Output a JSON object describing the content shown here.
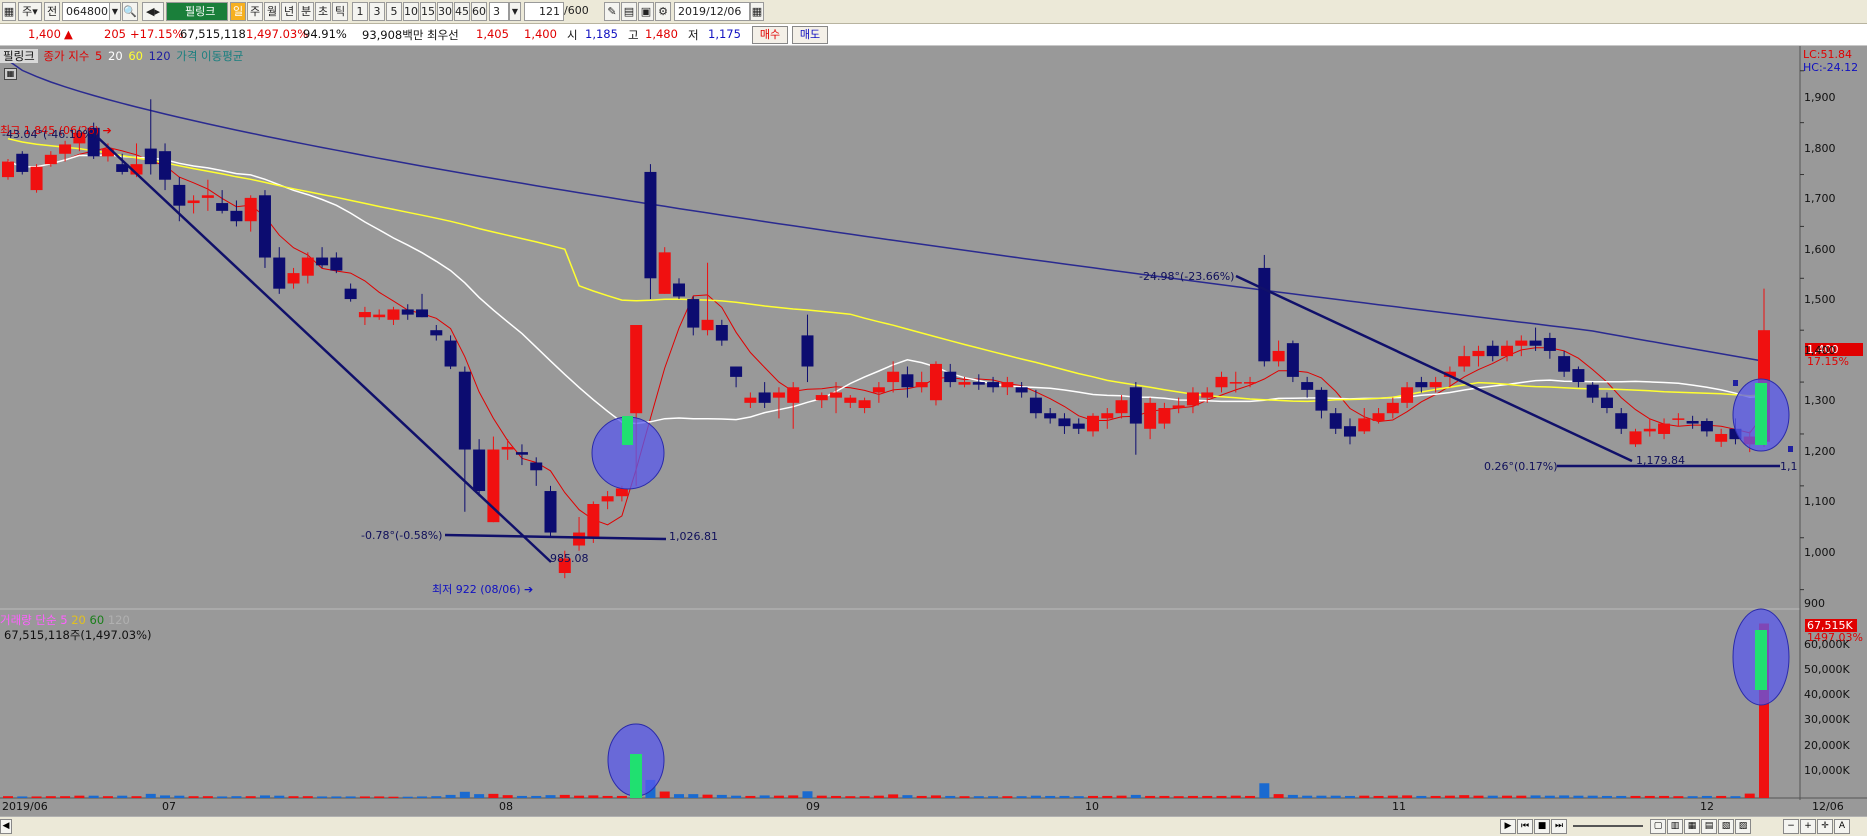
{
  "toolbar": {
    "type_label": "주",
    "period_label": "전",
    "code": "064800",
    "stock_name": "필링크",
    "mode_char": "일",
    "periods": [
      "주",
      "월",
      "년",
      "분",
      "초",
      "틱"
    ],
    "intervals": [
      "1",
      "3",
      "5",
      "10",
      "15",
      "30",
      "45",
      "60"
    ],
    "interval_value": "3",
    "count": "121",
    "count_max": "/600",
    "date": "2019/12/06"
  },
  "info": {
    "price": "1,400",
    "change": "205",
    "change_pct": "+17.15%",
    "volume": "67,515,118",
    "volume_ratio": "1,497.03%",
    "strength": "94.91%",
    "amount": "93,908백만",
    "ask_label": "최우선",
    "ask": "1,405",
    "bid": "1,400",
    "open_label": "시",
    "open": "1,185",
    "high_label": "고",
    "high": "1,480",
    "low_label": "저",
    "low": "1,175",
    "buy_label": "매수",
    "sell_label": "매도"
  },
  "legend_price": {
    "name": "필링크",
    "ma_label": "종가 지수",
    "ma5": "5",
    "ma20": "20",
    "ma60": "60",
    "ma120": "120",
    "title": "가격 이동평균"
  },
  "legend_volume": {
    "name": "거래량",
    "ma_label": "단순",
    "ma5": "5",
    "ma20": "20",
    "ma60": "60",
    "ma120": "120",
    "info": "67,515,118주(1,497.03%)"
  },
  "right_info": {
    "lc": "LC:51.84",
    "hc": "HC:-24.12",
    "price_tag": "1,400",
    "price_pct": "17.15%",
    "vol_tag": "67,515K",
    "vol_pct": "1497.03%"
  },
  "y_axis_price": [
    "1,900",
    "1,800",
    "1,700",
    "1,600",
    "1,500",
    "1,400",
    "1,300",
    "1,200",
    "1,100",
    "1,000",
    "900"
  ],
  "y_axis_volume": [
    "60,000K",
    "50,000K",
    "40,000K",
    "30,000K",
    "20,000K",
    "10,000K"
  ],
  "x_axis": [
    "2019/06",
    "07",
    "08",
    "09",
    "10",
    "11",
    "12",
    "12/06"
  ],
  "annotations": {
    "high_label": "최고 1,845 (06/26)",
    "low_label": "최저 922 (08/06)",
    "trend1_angle": "-43.04°(-46.10%)",
    "trend2_angle": "-0.78°(-0.58%)",
    "trend2_value": "1,026.81",
    "trend2_low": "985.08",
    "trend3_angle": "-24.98°(-23.66%)",
    "trend4_angle": "0.26°(0.17%)",
    "trend4_value": "1,179.84",
    "trend4_right": "1,1"
  },
  "chart_data": {
    "type": "candlestick",
    "x_range": [
      "2019/06",
      "2019/12/06"
    ],
    "price_ylim": [
      880,
      1940
    ],
    "volume_ylim": [
      0,
      65000
    ],
    "candles": [
      {
        "o": 1695,
        "h": 1730,
        "l": 1690,
        "c": 1725,
        "v": 700
      },
      {
        "o": 1740,
        "h": 1745,
        "l": 1700,
        "c": 1705,
        "v": 600
      },
      {
        "o": 1670,
        "h": 1720,
        "l": 1665,
        "c": 1715,
        "v": 600
      },
      {
        "o": 1720,
        "h": 1745,
        "l": 1715,
        "c": 1738,
        "v": 700
      },
      {
        "o": 1740,
        "h": 1765,
        "l": 1725,
        "c": 1758,
        "v": 700
      },
      {
        "o": 1760,
        "h": 1790,
        "l": 1745,
        "c": 1780,
        "v": 900
      },
      {
        "o": 1790,
        "h": 1800,
        "l": 1730,
        "c": 1735,
        "v": 900
      },
      {
        "o": 1735,
        "h": 1760,
        "l": 1725,
        "c": 1750,
        "v": 700
      },
      {
        "o": 1720,
        "h": 1740,
        "l": 1700,
        "c": 1705,
        "v": 900
      },
      {
        "o": 1700,
        "h": 1760,
        "l": 1695,
        "c": 1720,
        "v": 700
      },
      {
        "o": 1750,
        "h": 1845,
        "l": 1700,
        "c": 1720,
        "v": 1600
      },
      {
        "o": 1745,
        "h": 1760,
        "l": 1670,
        "c": 1690,
        "v": 1000
      },
      {
        "o": 1680,
        "h": 1695,
        "l": 1610,
        "c": 1640,
        "v": 900
      },
      {
        "o": 1645,
        "h": 1660,
        "l": 1625,
        "c": 1650,
        "v": 700
      },
      {
        "o": 1655,
        "h": 1690,
        "l": 1630,
        "c": 1660,
        "v": 700
      },
      {
        "o": 1645,
        "h": 1670,
        "l": 1625,
        "c": 1630,
        "v": 600
      },
      {
        "o": 1630,
        "h": 1650,
        "l": 1600,
        "c": 1610,
        "v": 700
      },
      {
        "o": 1610,
        "h": 1660,
        "l": 1590,
        "c": 1655,
        "v": 700
      },
      {
        "o": 1660,
        "h": 1670,
        "l": 1520,
        "c": 1540,
        "v": 1000
      },
      {
        "o": 1540,
        "h": 1560,
        "l": 1470,
        "c": 1480,
        "v": 900
      },
      {
        "o": 1490,
        "h": 1520,
        "l": 1480,
        "c": 1510,
        "v": 700
      },
      {
        "o": 1505,
        "h": 1550,
        "l": 1490,
        "c": 1540,
        "v": 700
      },
      {
        "o": 1540,
        "h": 1560,
        "l": 1520,
        "c": 1525,
        "v": 600
      },
      {
        "o": 1540,
        "h": 1550,
        "l": 1510,
        "c": 1515,
        "v": 600
      },
      {
        "o": 1480,
        "h": 1490,
        "l": 1455,
        "c": 1460,
        "v": 600
      },
      {
        "o": 1425,
        "h": 1445,
        "l": 1410,
        "c": 1435,
        "v": 600
      },
      {
        "o": 1425,
        "h": 1440,
        "l": 1420,
        "c": 1430,
        "v": 600
      },
      {
        "o": 1420,
        "h": 1445,
        "l": 1410,
        "c": 1440,
        "v": 500
      },
      {
        "o": 1440,
        "h": 1450,
        "l": 1420,
        "c": 1430,
        "v": 500
      },
      {
        "o": 1440,
        "h": 1470,
        "l": 1425,
        "c": 1425,
        "v": 600
      },
      {
        "o": 1400,
        "h": 1410,
        "l": 1380,
        "c": 1390,
        "v": 700
      },
      {
        "o": 1380,
        "h": 1390,
        "l": 1325,
        "c": 1330,
        "v": 1200
      },
      {
        "o": 1320,
        "h": 1330,
        "l": 1050,
        "c": 1170,
        "v": 2400
      },
      {
        "o": 1170,
        "h": 1190,
        "l": 1080,
        "c": 1090,
        "v": 1500
      },
      {
        "o": 1030,
        "h": 1195,
        "l": 1030,
        "c": 1170,
        "v": 1600
      },
      {
        "o": 1170,
        "h": 1190,
        "l": 1150,
        "c": 1175,
        "v": 1100
      },
      {
        "o": 1165,
        "h": 1180,
        "l": 1140,
        "c": 1160,
        "v": 800
      },
      {
        "o": 1145,
        "h": 1155,
        "l": 1100,
        "c": 1130,
        "v": 800
      },
      {
        "o": 1090,
        "h": 1100,
        "l": 1000,
        "c": 1010,
        "v": 1100
      },
      {
        "o": 932,
        "h": 975,
        "l": 922,
        "c": 960,
        "v": 1200
      },
      {
        "o": 985,
        "h": 1040,
        "l": 975,
        "c": 1010,
        "v": 900
      },
      {
        "o": 1000,
        "h": 1070,
        "l": 990,
        "c": 1065,
        "v": 1000
      },
      {
        "o": 1070,
        "h": 1090,
        "l": 1055,
        "c": 1080,
        "v": 800
      },
      {
        "o": 1080,
        "h": 1100,
        "l": 1070,
        "c": 1095,
        "v": 800
      },
      {
        "o": 1240,
        "h": 1340,
        "l": 1100,
        "c": 1410,
        "v": 4500
      },
      {
        "o": 1705,
        "h": 1720,
        "l": 1460,
        "c": 1500,
        "v": 7000
      },
      {
        "o": 1470,
        "h": 1560,
        "l": 1470,
        "c": 1550,
        "v": 2500
      },
      {
        "o": 1490,
        "h": 1500,
        "l": 1460,
        "c": 1465,
        "v": 1500
      },
      {
        "o": 1460,
        "h": 1465,
        "l": 1390,
        "c": 1405,
        "v": 1500
      },
      {
        "o": 1400,
        "h": 1530,
        "l": 1390,
        "c": 1420,
        "v": 1300
      },
      {
        "o": 1410,
        "h": 1420,
        "l": 1370,
        "c": 1380,
        "v": 1200
      },
      {
        "o": 1330,
        "h": 1330,
        "l": 1290,
        "c": 1310,
        "v": 900
      },
      {
        "o": 1260,
        "h": 1280,
        "l": 1250,
        "c": 1270,
        "v": 800
      },
      {
        "o": 1280,
        "h": 1300,
        "l": 1250,
        "c": 1260,
        "v": 1000
      },
      {
        "o": 1270,
        "h": 1290,
        "l": 1230,
        "c": 1280,
        "v": 900
      },
      {
        "o": 1260,
        "h": 1300,
        "l": 1210,
        "c": 1290,
        "v": 1000
      },
      {
        "o": 1390,
        "h": 1430,
        "l": 1300,
        "c": 1330,
        "v": 2600
      },
      {
        "o": 1265,
        "h": 1280,
        "l": 1250,
        "c": 1275,
        "v": 900
      },
      {
        "o": 1270,
        "h": 1300,
        "l": 1240,
        "c": 1280,
        "v": 800
      },
      {
        "o": 1260,
        "h": 1275,
        "l": 1250,
        "c": 1270,
        "v": 700
      },
      {
        "o": 1250,
        "h": 1270,
        "l": 1240,
        "c": 1265,
        "v": 700
      },
      {
        "o": 1280,
        "h": 1300,
        "l": 1260,
        "c": 1290,
        "v": 900
      },
      {
        "o": 1300,
        "h": 1340,
        "l": 1280,
        "c": 1320,
        "v": 1400
      },
      {
        "o": 1315,
        "h": 1330,
        "l": 1270,
        "c": 1290,
        "v": 1100
      },
      {
        "o": 1290,
        "h": 1320,
        "l": 1280,
        "c": 1300,
        "v": 800
      },
      {
        "o": 1265,
        "h": 1340,
        "l": 1255,
        "c": 1335,
        "v": 1000
      },
      {
        "o": 1320,
        "h": 1335,
        "l": 1290,
        "c": 1300,
        "v": 800
      },
      {
        "o": 1295,
        "h": 1310,
        "l": 1290,
        "c": 1300,
        "v": 700
      },
      {
        "o": 1300,
        "h": 1315,
        "l": 1285,
        "c": 1295,
        "v": 700
      },
      {
        "o": 1300,
        "h": 1310,
        "l": 1280,
        "c": 1290,
        "v": 700
      },
      {
        "o": 1290,
        "h": 1310,
        "l": 1275,
        "c": 1300,
        "v": 700
      },
      {
        "o": 1290,
        "h": 1300,
        "l": 1270,
        "c": 1280,
        "v": 700
      },
      {
        "o": 1270,
        "h": 1285,
        "l": 1230,
        "c": 1240,
        "v": 900
      },
      {
        "o": 1240,
        "h": 1250,
        "l": 1220,
        "c": 1230,
        "v": 800
      },
      {
        "o": 1230,
        "h": 1240,
        "l": 1200,
        "c": 1215,
        "v": 800
      },
      {
        "o": 1220,
        "h": 1230,
        "l": 1200,
        "c": 1210,
        "v": 700
      },
      {
        "o": 1205,
        "h": 1240,
        "l": 1195,
        "c": 1235,
        "v": 800
      },
      {
        "o": 1230,
        "h": 1250,
        "l": 1210,
        "c": 1240,
        "v": 800
      },
      {
        "o": 1240,
        "h": 1275,
        "l": 1230,
        "c": 1265,
        "v": 900
      },
      {
        "o": 1290,
        "h": 1300,
        "l": 1160,
        "c": 1220,
        "v": 1200
      },
      {
        "o": 1210,
        "h": 1270,
        "l": 1190,
        "c": 1260,
        "v": 800
      },
      {
        "o": 1220,
        "h": 1260,
        "l": 1210,
        "c": 1250,
        "v": 800
      },
      {
        "o": 1250,
        "h": 1270,
        "l": 1240,
        "c": 1255,
        "v": 700
      },
      {
        "o": 1255,
        "h": 1290,
        "l": 1240,
        "c": 1280,
        "v": 800
      },
      {
        "o": 1270,
        "h": 1290,
        "l": 1260,
        "c": 1280,
        "v": 800
      },
      {
        "o": 1290,
        "h": 1320,
        "l": 1280,
        "c": 1310,
        "v": 800
      },
      {
        "o": 1300,
        "h": 1320,
        "l": 1280,
        "c": 1300,
        "v": 900
      },
      {
        "o": 1300,
        "h": 1310,
        "l": 1290,
        "c": 1300,
        "v": 800
      },
      {
        "o": 1520,
        "h": 1545,
        "l": 1330,
        "c": 1340,
        "v": 5700
      },
      {
        "o": 1340,
        "h": 1380,
        "l": 1330,
        "c": 1360,
        "v": 1500
      },
      {
        "o": 1375,
        "h": 1380,
        "l": 1300,
        "c": 1310,
        "v": 1200
      },
      {
        "o": 1300,
        "h": 1310,
        "l": 1270,
        "c": 1285,
        "v": 900
      },
      {
        "o": 1285,
        "h": 1290,
        "l": 1230,
        "c": 1245,
        "v": 900
      },
      {
        "o": 1240,
        "h": 1250,
        "l": 1200,
        "c": 1210,
        "v": 900
      },
      {
        "o": 1215,
        "h": 1230,
        "l": 1180,
        "c": 1195,
        "v": 800
      },
      {
        "o": 1205,
        "h": 1250,
        "l": 1200,
        "c": 1230,
        "v": 900
      },
      {
        "o": 1225,
        "h": 1250,
        "l": 1220,
        "c": 1240,
        "v": 800
      },
      {
        "o": 1240,
        "h": 1270,
        "l": 1230,
        "c": 1260,
        "v": 900
      },
      {
        "o": 1260,
        "h": 1300,
        "l": 1250,
        "c": 1290,
        "v": 1000
      },
      {
        "o": 1300,
        "h": 1310,
        "l": 1280,
        "c": 1290,
        "v": 800
      },
      {
        "o": 1290,
        "h": 1310,
        "l": 1280,
        "c": 1300,
        "v": 800
      },
      {
        "o": 1310,
        "h": 1330,
        "l": 1290,
        "c": 1320,
        "v": 900
      },
      {
        "o": 1330,
        "h": 1370,
        "l": 1320,
        "c": 1350,
        "v": 1100
      },
      {
        "o": 1350,
        "h": 1370,
        "l": 1330,
        "c": 1360,
        "v": 900
      },
      {
        "o": 1370,
        "h": 1380,
        "l": 1340,
        "c": 1350,
        "v": 900
      },
      {
        "o": 1350,
        "h": 1380,
        "l": 1340,
        "c": 1370,
        "v": 900
      },
      {
        "o": 1370,
        "h": 1390,
        "l": 1350,
        "c": 1380,
        "v": 900
      },
      {
        "o": 1380,
        "h": 1405,
        "l": 1360,
        "c": 1370,
        "v": 1000
      },
      {
        "o": 1385,
        "h": 1395,
        "l": 1345,
        "c": 1360,
        "v": 900
      },
      {
        "o": 1350,
        "h": 1360,
        "l": 1310,
        "c": 1320,
        "v": 1000
      },
      {
        "o": 1325,
        "h": 1330,
        "l": 1290,
        "c": 1300,
        "v": 900
      },
      {
        "o": 1295,
        "h": 1300,
        "l": 1260,
        "c": 1270,
        "v": 900
      },
      {
        "o": 1270,
        "h": 1280,
        "l": 1240,
        "c": 1250,
        "v": 800
      },
      {
        "o": 1240,
        "h": 1250,
        "l": 1200,
        "c": 1210,
        "v": 800
      },
      {
        "o": 1180,
        "h": 1210,
        "l": 1175,
        "c": 1205,
        "v": 800
      },
      {
        "o": 1205,
        "h": 1230,
        "l": 1195,
        "c": 1210,
        "v": 800
      },
      {
        "o": 1200,
        "h": 1230,
        "l": 1190,
        "c": 1220,
        "v": 800
      },
      {
        "o": 1230,
        "h": 1240,
        "l": 1215,
        "c": 1230,
        "v": 700
      },
      {
        "o": 1225,
        "h": 1235,
        "l": 1210,
        "c": 1220,
        "v": 700
      },
      {
        "o": 1225,
        "h": 1230,
        "l": 1195,
        "c": 1205,
        "v": 800
      },
      {
        "o": 1185,
        "h": 1210,
        "l": 1175,
        "c": 1200,
        "v": 800
      },
      {
        "o": 1210,
        "h": 1230,
        "l": 1180,
        "c": 1190,
        "v": 700
      },
      {
        "o": 1180,
        "h": 1205,
        "l": 1165,
        "c": 1195,
        "v": 1700
      },
      {
        "o": 1185,
        "h": 1480,
        "l": 1175,
        "c": 1400,
        "v": 67515
      }
    ]
  }
}
